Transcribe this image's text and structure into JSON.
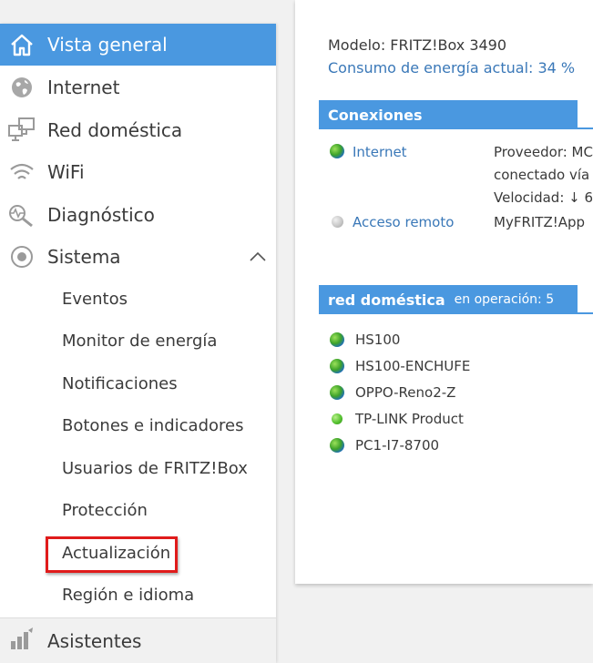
{
  "sidebar": {
    "items": [
      {
        "label": "Vista general",
        "icon": "home-icon"
      },
      {
        "label": "Internet",
        "icon": "globe-icon"
      },
      {
        "label": "Red doméstica",
        "icon": "network-icon"
      },
      {
        "label": "WiFi",
        "icon": "wifi-icon"
      },
      {
        "label": "Diagnóstico",
        "icon": "diagnostics-icon"
      },
      {
        "label": "Sistema",
        "icon": "system-icon"
      }
    ],
    "system_submenu": [
      "Eventos",
      "Monitor de energía",
      "Notificaciones",
      "Botones e indicadores",
      "Usuarios de FRITZ!Box",
      "Protección",
      "Actualización",
      "Región e idioma"
    ],
    "assistants_label": "Asistentes"
  },
  "main": {
    "model": "Modelo: FRITZ!Box 3490",
    "energy": "Consumo de energía actual: 34 %",
    "connections": {
      "title": "Conexiones",
      "rows": [
        {
          "name": "Internet",
          "details": [
            "Proveedor: MC",
            "conectado vía",
            "Velocidad: ↓ 6"
          ],
          "status": "online"
        },
        {
          "name": "Acceso remoto",
          "details": [
            "MyFRITZ!App"
          ],
          "status": "offline"
        }
      ]
    },
    "home_network": {
      "title": "red doméstica",
      "status": "en operación: 5",
      "devices": [
        {
          "name": "HS100",
          "type": "globe"
        },
        {
          "name": "HS100-ENCHUFE",
          "type": "globe"
        },
        {
          "name": "OPPO-Reno2-Z",
          "type": "globe"
        },
        {
          "name": "TP-LINK Product",
          "type": "green"
        },
        {
          "name": "PC1-I7-8700",
          "type": "globe"
        }
      ]
    }
  },
  "colors": {
    "accent": "#4a98e0",
    "link": "#3a78b8",
    "highlight_box": "#e01b1b"
  }
}
